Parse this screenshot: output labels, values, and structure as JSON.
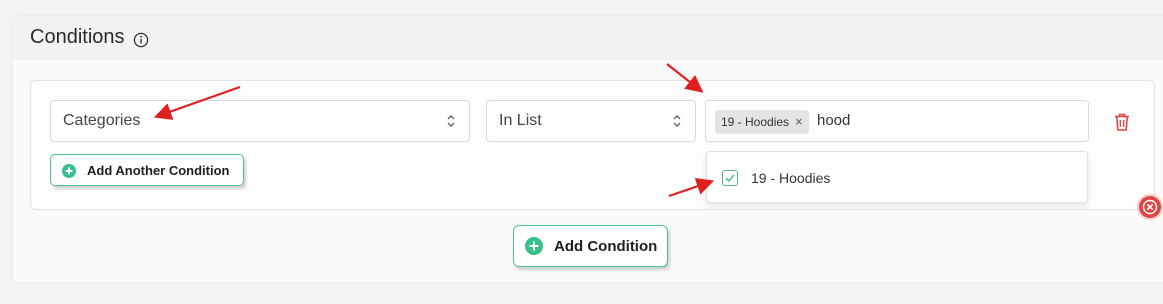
{
  "panel": {
    "title": "Conditions",
    "info_icon": "info-circle-icon"
  },
  "condition_row": {
    "field_select": {
      "value": "Categories",
      "icon": "chevron-up-down-icon"
    },
    "operator_select": {
      "value": "In List",
      "icon": "chevron-up-down-icon"
    },
    "value_select": {
      "selected_tags": [
        {
          "label": "19 - Hoodies",
          "remove_icon": "x-icon",
          "remove_symbol": "×"
        }
      ],
      "search_text": "hood"
    },
    "delete_icon": "trash-icon"
  },
  "dropdown": {
    "options": [
      {
        "label": "19 - Hoodies",
        "checked": true,
        "icon": "checkbox-checked-icon"
      }
    ]
  },
  "buttons": {
    "add_another_condition": "Add Another Condition",
    "add_condition": "Add Condition",
    "plus_icon": "plus-circle-icon"
  },
  "colors": {
    "accent_green": "#36c08a",
    "button_border": "#4fc293",
    "delete_red": "#e04545",
    "annotation_arrow": "#e02020"
  },
  "annotations": {
    "arrows": [
      "red-arrow-icon",
      "red-arrow-icon",
      "red-arrow-icon"
    ]
  }
}
